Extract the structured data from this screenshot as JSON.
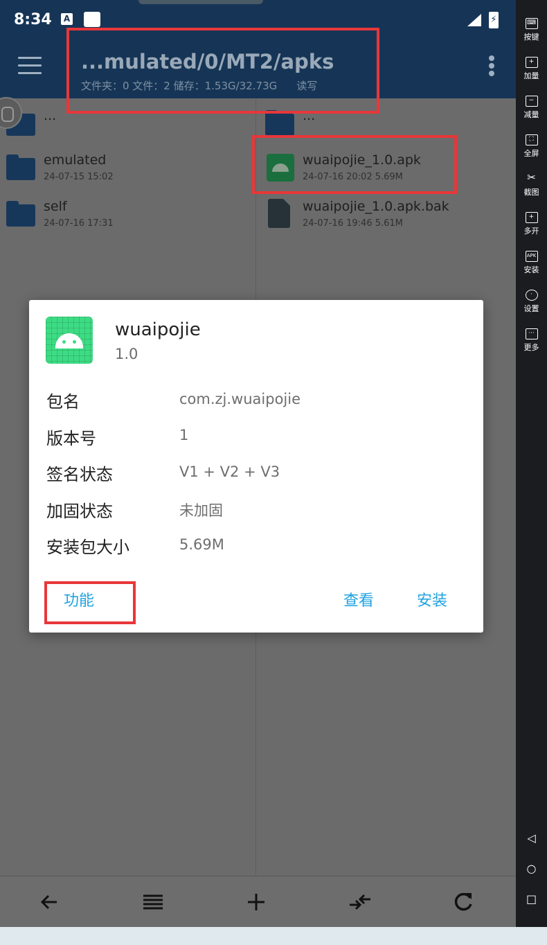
{
  "statusbar": {
    "time": "8:34",
    "badge": "A",
    "battery_glyph": "⚡"
  },
  "toolbar": {
    "path": "...mulated/0/MT2/apks",
    "info": "文件夹：0  文件：2  储存：1.53G/32.73G",
    "mode": "读写"
  },
  "left_pane": {
    "items": [
      {
        "name": "...",
        "meta": "",
        "icon": "folder-icon"
      },
      {
        "name": "emulated",
        "meta": "24-07-15 15:02",
        "icon": "folder-icon"
      },
      {
        "name": "self",
        "meta": "24-07-16 17:31",
        "icon": "folder-icon"
      }
    ]
  },
  "right_pane": {
    "items": [
      {
        "name": "...",
        "meta": "",
        "icon": "folder-icon"
      },
      {
        "name": "wuaipojie_1.0.apk",
        "meta": "24-07-16 20:02  5.69M",
        "icon": "apk-icon"
      },
      {
        "name": "wuaipojie_1.0.apk.bak",
        "meta": "24-07-16 19:46  5.61M",
        "icon": "file-icon"
      }
    ]
  },
  "dialog": {
    "app_name": "wuaipojie",
    "app_version": "1.0",
    "rows": [
      {
        "label": "包名",
        "value": "com.zj.wuaipojie"
      },
      {
        "label": "版本号",
        "value": "1"
      },
      {
        "label": "签名状态",
        "value": "V1 + V2 + V3"
      },
      {
        "label": "加固状态",
        "value": "未加固"
      },
      {
        "label": "安装包大小",
        "value": "5.69M"
      }
    ],
    "buttons": {
      "function": "功能",
      "view": "查看",
      "install": "安装"
    }
  },
  "bottombar": {
    "icons": [
      "back-arrow-icon",
      "list-icon",
      "plus-icon",
      "swap-icon",
      "refresh-icon"
    ]
  },
  "sidepanel": {
    "items": [
      {
        "label": "按键",
        "icon": "keyboard-icon"
      },
      {
        "label": "加量",
        "icon": "volume-up-icon"
      },
      {
        "label": "减量",
        "icon": "volume-down-icon"
      },
      {
        "label": "全屏",
        "icon": "fullscreen-icon"
      },
      {
        "label": "截图",
        "icon": "scissors-icon"
      },
      {
        "label": "多开",
        "icon": "multi-instance-icon"
      },
      {
        "label": "安装",
        "icon": "apk-install-icon"
      },
      {
        "label": "设置",
        "icon": "settings-icon"
      },
      {
        "label": "更多",
        "icon": "more-icon"
      }
    ],
    "nav": [
      "◁",
      "○",
      "□"
    ]
  },
  "colors": {
    "appbar": "#163556",
    "accent": "#1fa3e0",
    "highlight": "#e8373a",
    "scrim_background": "#6b6b6b"
  }
}
